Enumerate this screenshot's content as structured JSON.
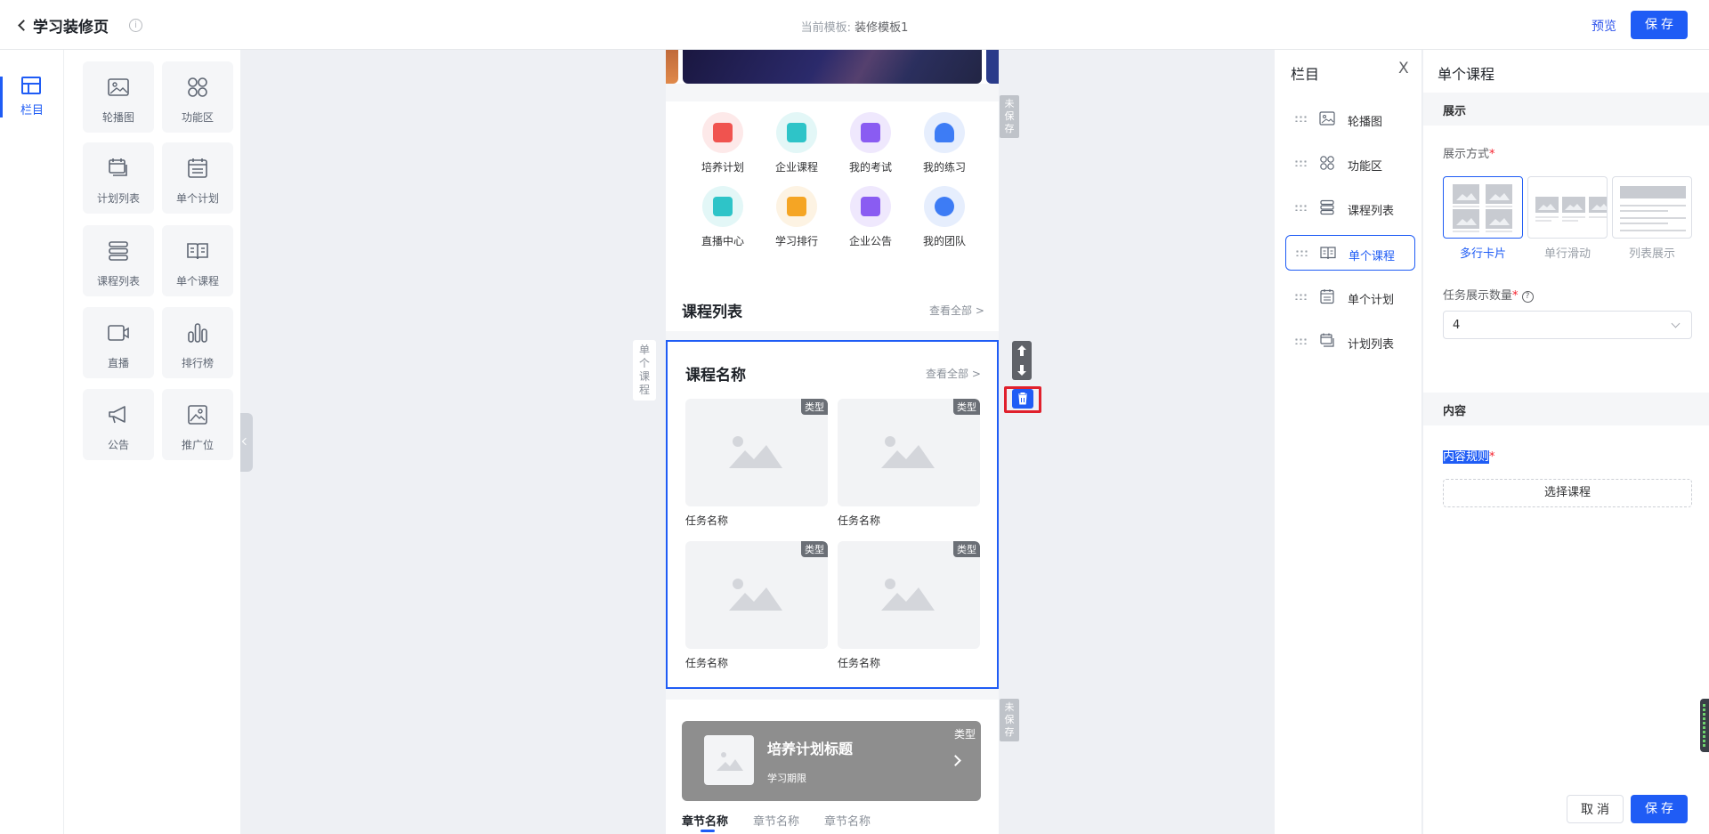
{
  "header": {
    "back_title": "学习装修页",
    "info_icon": "i",
    "template_label": "当前模板:",
    "template_name": "装修模板1",
    "preview": "预览",
    "save": "保存"
  },
  "left_nav": {
    "label": "栏目"
  },
  "palette": [
    {
      "label": "轮播图",
      "icon": "image-icon"
    },
    {
      "label": "功能区",
      "icon": "grid-icon"
    },
    {
      "label": "计划列表",
      "icon": "stack-calendar-icon"
    },
    {
      "label": "单个计划",
      "icon": "calendar-icon"
    },
    {
      "label": "课程列表",
      "icon": "layers-icon"
    },
    {
      "label": "单个课程",
      "icon": "book-icon"
    },
    {
      "label": "直播",
      "icon": "video-icon"
    },
    {
      "label": "排行榜",
      "icon": "bar-chart-icon"
    },
    {
      "label": "公告",
      "icon": "megaphone-icon"
    },
    {
      "label": "推广位",
      "icon": "promo-image-icon"
    }
  ],
  "phone": {
    "functions": [
      {
        "label": "培养计划",
        "color": "#f0534f"
      },
      {
        "label": "企业课程",
        "color": "#2ec4c8"
      },
      {
        "label": "我的考试",
        "color": "#8a5cf2"
      },
      {
        "label": "我的练习",
        "color": "#3d7cf5"
      },
      {
        "label": "直播中心",
        "color": "#2ec4c8"
      },
      {
        "label": "学习排行",
        "color": "#f5a524"
      },
      {
        "label": "企业公告",
        "color": "#8a5cf2"
      },
      {
        "label": "我的团队",
        "color": "#3d7cf5"
      }
    ],
    "course_list": {
      "title": "课程列表",
      "view_all": "查看全部 >"
    },
    "single_course": {
      "title": "课程名称",
      "view_all": "查看全部 >",
      "cards": [
        {
          "badge": "类型",
          "task": "任务名称"
        },
        {
          "badge": "类型",
          "task": "任务名称"
        },
        {
          "badge": "类型",
          "task": "任务名称"
        },
        {
          "badge": "类型",
          "task": "任务名称"
        }
      ]
    },
    "plan": {
      "title": "培养计划标题",
      "subtitle": "学习期限",
      "badge": "类型",
      "chapters": [
        "章节名称",
        "章节名称",
        "章节名称"
      ]
    }
  },
  "side_tags": {
    "unsaved_1": "未保存",
    "unsaved_2": "未保存",
    "selected_label": "单个课程"
  },
  "column_panel": {
    "title": "栏目",
    "close": "X",
    "items": [
      {
        "label": "轮播图",
        "icon": "image-icon",
        "active": false
      },
      {
        "label": "功能区",
        "icon": "grid-icon",
        "active": false
      },
      {
        "label": "课程列表",
        "icon": "layers-icon",
        "active": false
      },
      {
        "label": "单个课程",
        "icon": "book-icon",
        "active": true
      },
      {
        "label": "单个计划",
        "icon": "calendar-icon",
        "active": false
      },
      {
        "label": "计划列表",
        "icon": "stack-calendar-icon",
        "active": false
      }
    ]
  },
  "settings": {
    "title": "单个课程",
    "group_display": "展示",
    "display_mode_label": "展示方式",
    "modes": [
      "多行卡片",
      "单行滑动",
      "列表展示"
    ],
    "active_mode": "多行卡片",
    "count_label": "任务展示数量",
    "count_value": "4",
    "group_content": "内容",
    "content_rule_label": "内容规则",
    "choose_course": "选择课程",
    "cancel": "取消",
    "save": "保存",
    "required_mark": "*",
    "help_icon": "?"
  }
}
